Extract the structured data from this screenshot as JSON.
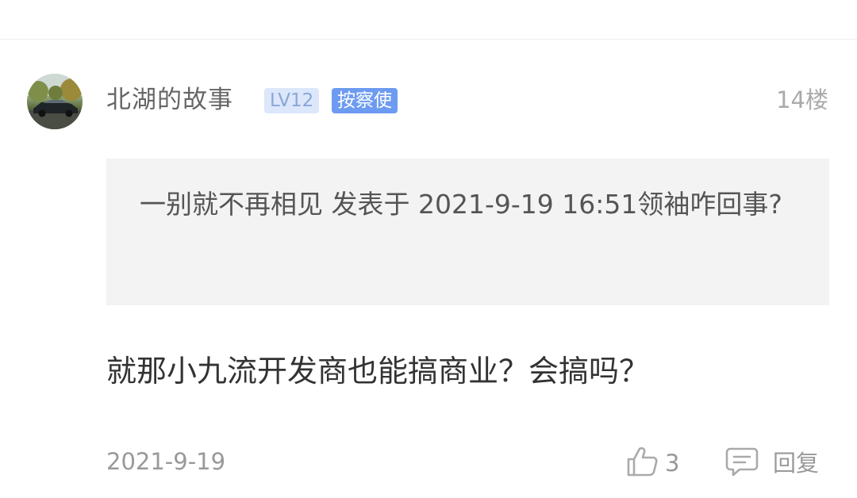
{
  "post": {
    "username": "北湖的故事",
    "level_badge": "LV12",
    "title_badge": "按察使",
    "floor": "14楼",
    "quote": "一别就不再相见 发表于 2021-9-19 16:51领袖咋回事?",
    "content": "就那小九流开发商也能搞商业？会搞吗？",
    "date": "2021-9-19",
    "like_count": "3",
    "reply_label": "回复"
  },
  "icons": {
    "avatar": "car-photo-avatar",
    "like": "thumbs-up-icon",
    "reply": "comment-icon"
  },
  "colors": {
    "level_badge_bg": "#dce7fb",
    "title_badge_bg": "#6d9bf1",
    "quote_bg": "#f3f3f3"
  }
}
